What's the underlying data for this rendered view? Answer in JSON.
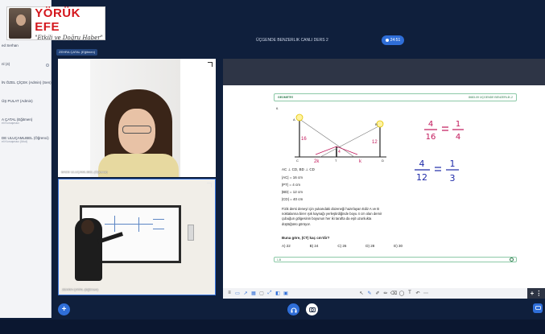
{
  "logo": {
    "name": "YÖRÜK EFE",
    "tagline": "\"Etkili ve Doğru Haber\""
  },
  "session": {
    "title": "ÜÇGENDE BENZERLIK CANLI DERS 2",
    "timer": "24:51"
  },
  "active_speaker": "ZEHRA ÇATAL (Eğitmen)",
  "participants": [
    {
      "name": "ed Serhan",
      "sub": ""
    },
    {
      "name": "nl (4)",
      "sub": ""
    },
    {
      "name": "İN ÖZEL ÇİÇEK (Admin) (Sen)",
      "sub": ""
    },
    {
      "name": "ÜŞ PULAT (Admin)",
      "sub": ""
    },
    {
      "name": "A ÇATAL (Eğitmen)",
      "sub": "eli Konuşmacı"
    },
    {
      "name": "DE ULUÇAMLIBEL (Öğrenci)",
      "sub": "eli Konuşmacı (Mod)"
    }
  ],
  "tiles": {
    "student_label": "BADE ULUÇAMLIBEL (Öğrenci)",
    "teacher_label": "ZEHRA ÇATAL (Eğitmen)"
  },
  "sheet": {
    "subject": "GEOMETRİ",
    "topic": "8683-09 ÜÇGENDE BENZERLİK-2",
    "question_number": "6.",
    "givens": [
      "AC ⊥ CD, BD ⊥ CD",
      "|AC| = 16 cm",
      "|PT| = 4 cm",
      "|BD| = 12 cm",
      "|CD| = 40 cm"
    ],
    "paragraph": "Fizik dersi deneyi için yukarıdaki düzeneği hazırlayan Ediz A ve B noktalarına birer ışık kaynağı yerleştirdiğinde boyu 4 cm olan demir çubuğun gölgesinin boyunun her iki tarafta da eşit uzunlukta düştüğünü görüyor.",
    "question": "Buna göre, |CT| kaç cm'dir?",
    "options": [
      "A) 22",
      "B) 24",
      "C) 26",
      "D) 28",
      "E) 30"
    ],
    "answer_prefix": "1-B",
    "handwriting": {
      "eq1_left_num": "4",
      "eq1_left_den": "16",
      "eq1_right_num": "1",
      "eq1_right_den": "4",
      "eq2_left_num": "4",
      "eq2_left_den": "12",
      "eq2_right_num": "1",
      "eq2_right_den": "3",
      "fig_label_left": "16",
      "fig_label_right": "12",
      "fig_label_mid": "4",
      "fig_bottom_left": "2k",
      "fig_bottom_right": "k",
      "pt_a": "A",
      "pt_b": "B",
      "pt_c": "C",
      "pt_d": "D",
      "pt_t": "T"
    }
  },
  "colors": {
    "accent": "#2f6ed8",
    "background": "#0f1f3c",
    "ink_red": "#c2185b",
    "ink_blue": "#1e2aa8"
  }
}
